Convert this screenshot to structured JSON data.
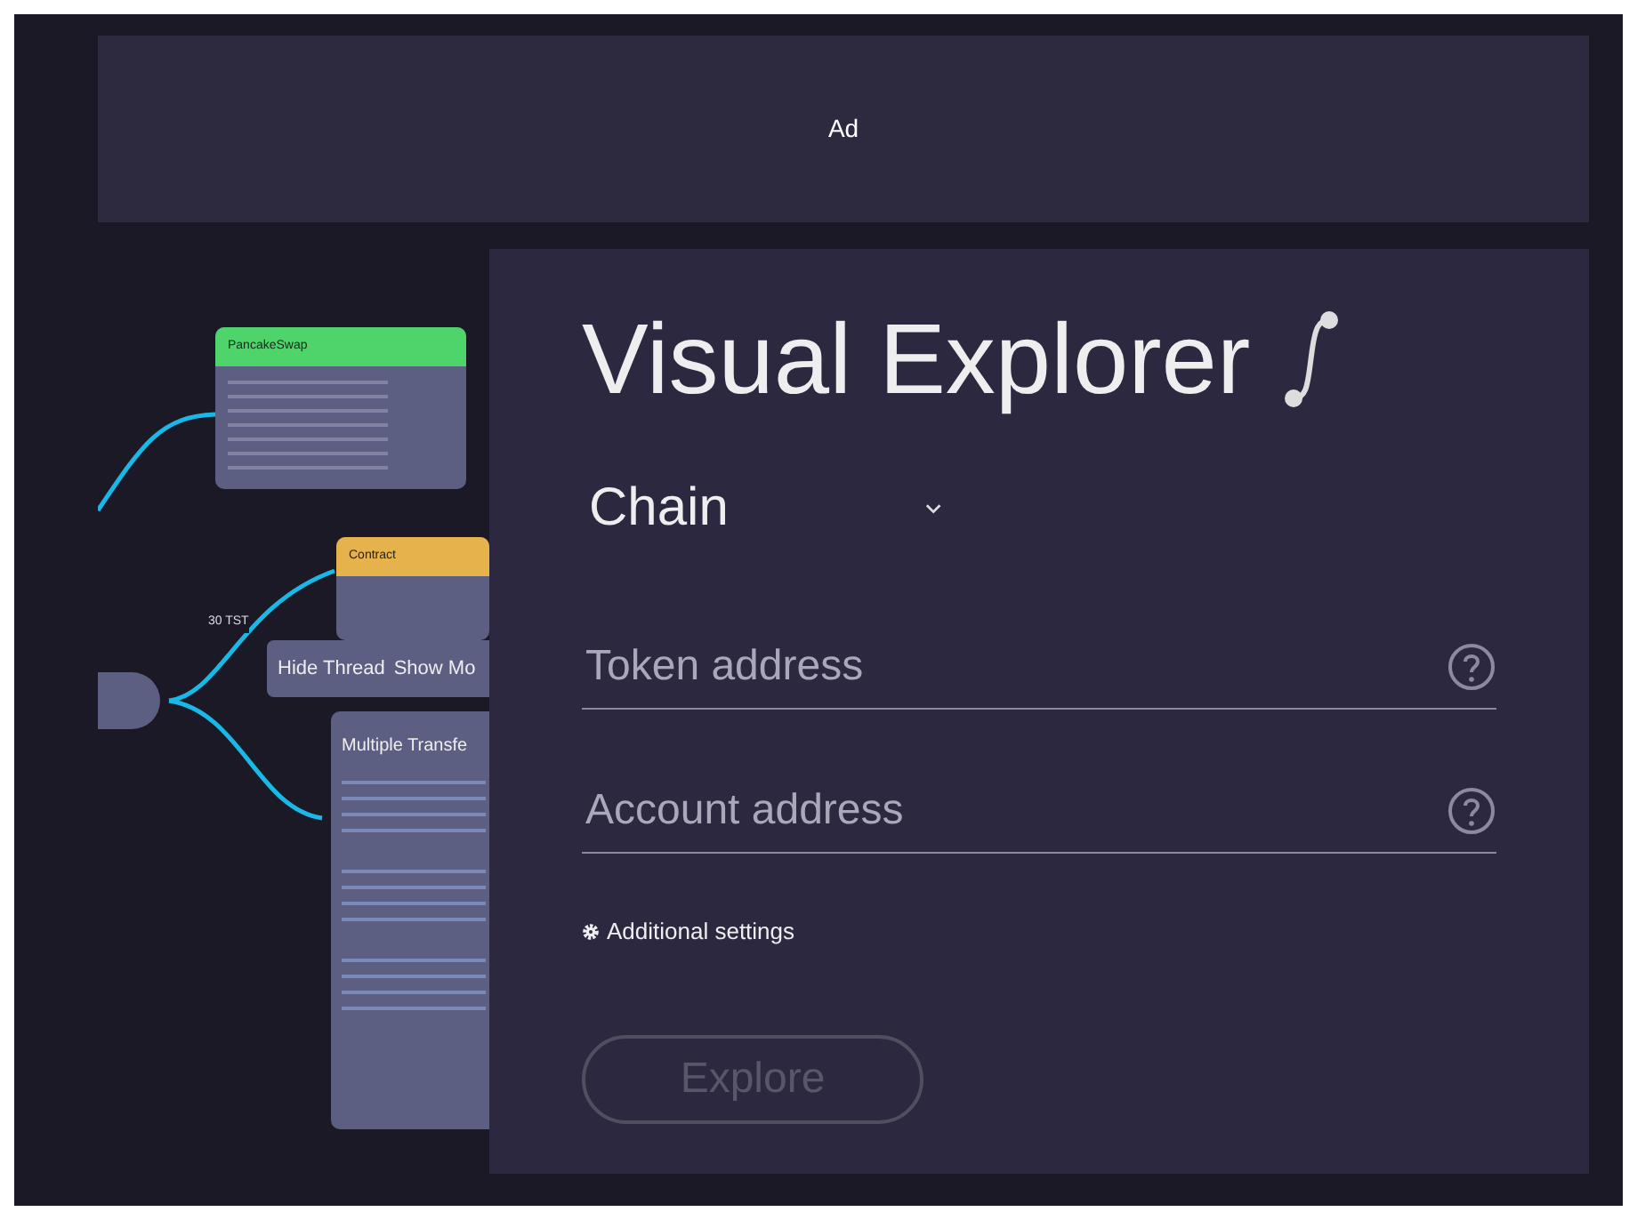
{
  "ad": {
    "label": "Ad"
  },
  "diagram": {
    "cards": [
      {
        "kind": "header",
        "title": "PancakeSwap",
        "color": "#4ed46a"
      },
      {
        "kind": "header",
        "title": "Contract",
        "color": "#e6b24c"
      }
    ],
    "edge_label": "30 TST",
    "thread_actions": [
      "Hide Thread",
      "Show Mo"
    ],
    "transfers_card": {
      "title": "Multiple Transfe"
    }
  },
  "explorer": {
    "title": "Visual Explorer",
    "chain": {
      "label": "Chain"
    },
    "fields": [
      {
        "placeholder": "Token address"
      },
      {
        "placeholder": "Account address"
      }
    ],
    "settings_link": "Additional settings",
    "explore_button": {
      "label": "Explore",
      "disabled": true
    }
  }
}
